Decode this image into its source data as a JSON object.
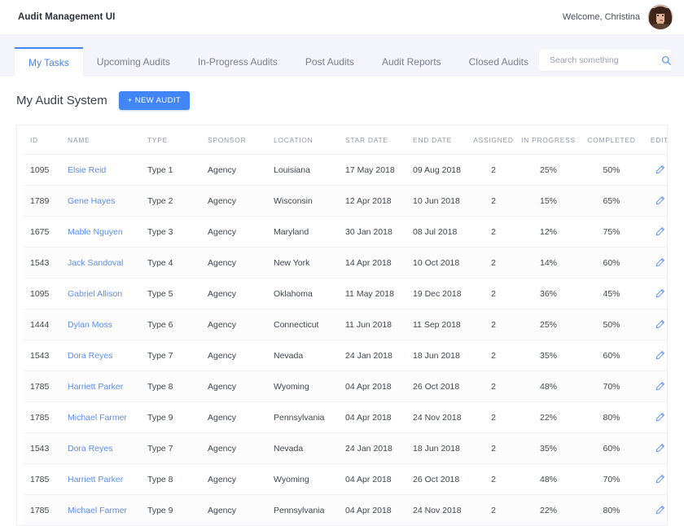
{
  "header": {
    "app_title": "Audit Management UI",
    "welcome_text": "Welcome, Christina",
    "avatar_name": "christina-avatar"
  },
  "tabs": [
    {
      "label": "My Tasks",
      "active": true
    },
    {
      "label": "Upcoming Audits",
      "active": false
    },
    {
      "label": "In-Progress Audits",
      "active": false
    },
    {
      "label": "Post Audits",
      "active": false
    },
    {
      "label": "Audit Reports",
      "active": false
    },
    {
      "label": "Closed Audits",
      "active": false
    }
  ],
  "search": {
    "placeholder": "Search something",
    "value": ""
  },
  "page": {
    "title": "My Audit System",
    "new_audit_label": "+ NEW AUDIT"
  },
  "table": {
    "columns": [
      "ID",
      "NAME",
      "TYPE",
      "SPONSOR",
      "LOCATION",
      "STAR DATE",
      "END DATE",
      "ASSIGNED",
      "IN PROGRESS",
      "COMPLETED",
      "EDIT"
    ],
    "rows": [
      {
        "id": "1095",
        "name": "Elsie Reid",
        "type": "Type 1",
        "sponsor": "Agency",
        "location": "Louisiana",
        "start": "17 May 2018",
        "end": "09 Aug 2018",
        "assigned": "2",
        "in_progress": "25%",
        "completed": "50%"
      },
      {
        "id": "1789",
        "name": "Gene Hayes",
        "type": "Type 2",
        "sponsor": "Agency",
        "location": "Wisconsin",
        "start": "12 Apr 2018",
        "end": "10 Jun 2018",
        "assigned": "2",
        "in_progress": "15%",
        "completed": "65%"
      },
      {
        "id": "1675",
        "name": "Mable Nguyen",
        "type": "Type 3",
        "sponsor": "Agency",
        "location": "Maryland",
        "start": "30 Jan 2018",
        "end": "08 Jul 2018",
        "assigned": "2",
        "in_progress": "12%",
        "completed": "75%"
      },
      {
        "id": "1543",
        "name": "Jack Sandoval",
        "type": "Type 4",
        "sponsor": "Agency",
        "location": "New York",
        "start": "14 Apr 2018",
        "end": "10 Oct 2018",
        "assigned": "2",
        "in_progress": "14%",
        "completed": "60%"
      },
      {
        "id": "1095",
        "name": "Gabriel Allison",
        "type": "Type 5",
        "sponsor": "Agency",
        "location": "Oklahoma",
        "start": "11 May 2018",
        "end": "19 Dec 2018",
        "assigned": "2",
        "in_progress": "36%",
        "completed": "45%"
      },
      {
        "id": "1444",
        "name": "Dylan Moss",
        "type": "Type 6",
        "sponsor": "Agency",
        "location": "Connecticut",
        "start": "11 Jun 2018",
        "end": "11 Sep 2018",
        "assigned": "2",
        "in_progress": "25%",
        "completed": "50%"
      },
      {
        "id": "1543",
        "name": "Dora Reyes",
        "type": "Type 7",
        "sponsor": "Agency",
        "location": "Nevada",
        "start": "24 Jan 2018",
        "end": "18 Jun 2018",
        "assigned": "2",
        "in_progress": "35%",
        "completed": "60%"
      },
      {
        "id": "1785",
        "name": "Harriett Parker",
        "type": "Type 8",
        "sponsor": "Agency",
        "location": "Wyoming",
        "start": "04 Apr 2018",
        "end": "26 Oct 2018",
        "assigned": "2",
        "in_progress": "48%",
        "completed": "70%"
      },
      {
        "id": "1785",
        "name": "Michael Farmer",
        "type": "Type 9",
        "sponsor": "Agency",
        "location": "Pennsylvania",
        "start": "04 Apr 2018",
        "end": "24 Nov 2018",
        "assigned": "2",
        "in_progress": "22%",
        "completed": "80%"
      },
      {
        "id": "1543",
        "name": "Dora Reyes",
        "type": "Type 7",
        "sponsor": "Agency",
        "location": "Nevada",
        "start": "24 Jan 2018",
        "end": "18 Jun 2018",
        "assigned": "2",
        "in_progress": "35%",
        "completed": "60%"
      },
      {
        "id": "1785",
        "name": "Harriett Parker",
        "type": "Type 8",
        "sponsor": "Agency",
        "location": "Wyoming",
        "start": "04 Apr 2018",
        "end": "26 Oct 2018",
        "assigned": "2",
        "in_progress": "48%",
        "completed": "70%"
      },
      {
        "id": "1785",
        "name": "Michael Farmer",
        "type": "Type 9",
        "sponsor": "Agency",
        "location": "Pennsylvania",
        "start": "04 Apr 2018",
        "end": "24 Nov 2018",
        "assigned": "2",
        "in_progress": "22%",
        "completed": "80%"
      }
    ],
    "edit_icon": "pencil-icon"
  },
  "colors": {
    "accent": "#4285f4",
    "link": "#5a8ded",
    "tabbar_bg": "#f4f5fa",
    "text": "#40454f",
    "muted": "#9297a6"
  }
}
